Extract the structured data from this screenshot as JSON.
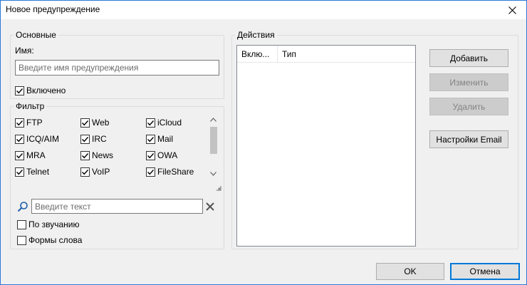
{
  "window": {
    "title": "Новое предупреждение"
  },
  "general": {
    "group_title": "Основные",
    "name_label": "Имя:",
    "name_value": "",
    "name_placeholder": "Введите имя предупреждения",
    "enabled_label": "Включено",
    "enabled_checked": true
  },
  "filter": {
    "group_title": "Фильтр",
    "items": [
      {
        "label": "FTP",
        "checked": true
      },
      {
        "label": "Web",
        "checked": true
      },
      {
        "label": "iCloud",
        "checked": true
      },
      {
        "label": "ICQ/AIM",
        "checked": true
      },
      {
        "label": "IRC",
        "checked": true
      },
      {
        "label": "Mail",
        "checked": true
      },
      {
        "label": "MRA",
        "checked": true
      },
      {
        "label": "News",
        "checked": true
      },
      {
        "label": "OWA",
        "checked": true
      },
      {
        "label": "Telnet",
        "checked": true
      },
      {
        "label": "VoIP",
        "checked": true
      },
      {
        "label": "FileShare",
        "checked": true
      }
    ],
    "search_value": "",
    "search_placeholder": "Введите текст",
    "by_sound_label": "По звучанию",
    "by_sound_checked": false,
    "word_forms_label": "Формы слова",
    "word_forms_checked": false
  },
  "actions": {
    "group_title": "Действия",
    "columns": [
      "Вклю...",
      "Тип"
    ],
    "rows": [],
    "add_label": "Добавить",
    "edit_label": "Изменить",
    "delete_label": "Удалить",
    "email_settings_label": "Настройки Email"
  },
  "footer": {
    "ok_label": "OK",
    "cancel_label": "Отмена"
  },
  "colors": {
    "window_border": "#2b79d8",
    "accent": "#0078d7",
    "background": "#f0f0f0",
    "disabled_button": "#cccccc"
  },
  "icons": {
    "close": "close-icon",
    "check": "check-icon",
    "search": "search-icon",
    "clear": "clear-icon",
    "scroll_up": "chevron-up-icon",
    "scroll_down": "chevron-down-icon",
    "grip": "resize-grip-icon"
  }
}
